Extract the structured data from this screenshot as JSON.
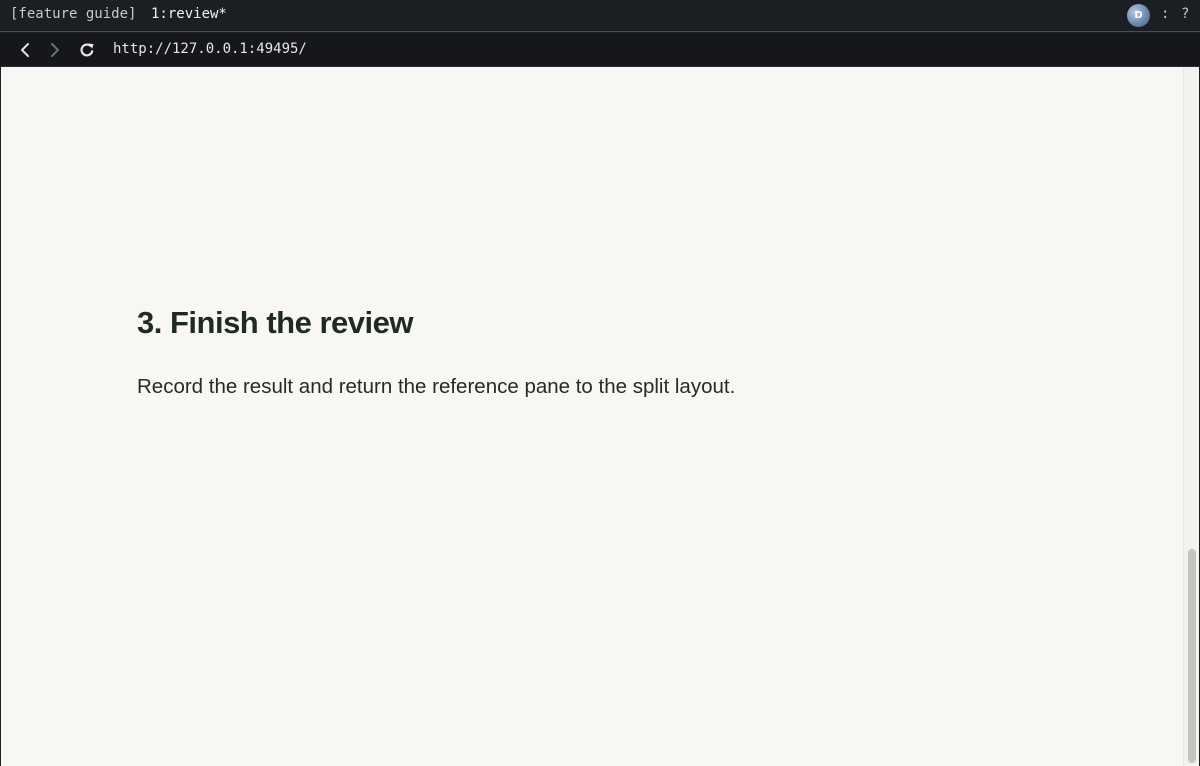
{
  "statusbar": {
    "session": "[feature guide]",
    "window": "1:review*",
    "avatar_initial": "D",
    "separator": ":",
    "help": "?"
  },
  "browser": {
    "url": "http://127.0.0.1:49495/",
    "icons": {
      "back": "chevron-left-icon",
      "forward": "chevron-right-icon",
      "reload": "reload-icon"
    }
  },
  "page": {
    "heading": "3. Finish the review",
    "paragraph": "Record the result and return the reference pane to the split layout."
  },
  "scrollbar": {
    "position_fraction": 1.0
  },
  "colors": {
    "chrome_bg": "#1b1e22",
    "page_bg": "#f8f7f3",
    "heading": "#1f2a24",
    "text": "#262b27"
  }
}
